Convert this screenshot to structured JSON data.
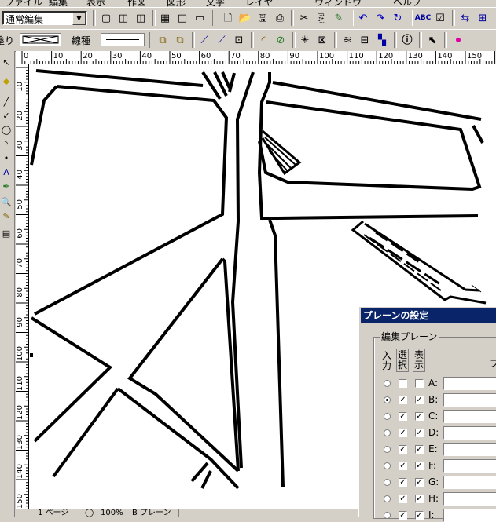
{
  "menu": {
    "items": [
      "ファイル",
      "編集",
      "表示",
      "作図",
      "図形",
      "文字",
      "レイヤ",
      "ウィンドウ",
      "ヘルプ"
    ]
  },
  "toolbar": {
    "mode_combo_value": "通常編集",
    "line_type_label": "線種",
    "clipped_left_label": "塗り"
  },
  "ruler": {
    "h_labels": [
      "0",
      "10",
      "20",
      "30",
      "40",
      "50",
      "60",
      "70",
      "80",
      "90",
      "100",
      "110",
      "120",
      "130",
      "140",
      "150"
    ],
    "v_labels": [
      "10",
      "20",
      "30",
      "40",
      "50",
      "60",
      "70",
      "80",
      "90",
      "100",
      "110",
      "120",
      "130",
      "140",
      "150"
    ]
  },
  "status": {
    "page": "1 ページ",
    "zoom": "100%",
    "plane": "B プレーン"
  },
  "plane_dialog": {
    "title": "プレーンの設定",
    "group_label": "編集プレーン",
    "col_input": "入力",
    "col_select": "選択",
    "col_display": "表示",
    "col_name_clip": "プ",
    "planes": [
      {
        "label": "A:",
        "input": false,
        "select": false,
        "display": false
      },
      {
        "label": "B:",
        "input": true,
        "select": true,
        "display": true
      },
      {
        "label": "C:",
        "input": false,
        "select": true,
        "display": true
      },
      {
        "label": "D:",
        "input": false,
        "select": true,
        "display": true
      },
      {
        "label": "E:",
        "input": false,
        "select": true,
        "display": true
      },
      {
        "label": "F:",
        "input": false,
        "select": true,
        "display": true
      },
      {
        "label": "G:",
        "input": false,
        "select": true,
        "display": true
      },
      {
        "label": "H:",
        "input": false,
        "select": true,
        "display": true
      },
      {
        "label": "I:",
        "input": false,
        "select": true,
        "display": true
      }
    ]
  },
  "icons": {
    "toolbar1": [
      "single-page-icon",
      "two-page-icon",
      "two-page-alt-icon",
      "grid-icon",
      "page-small-icon",
      "page-corner-icon",
      "new-doc-icon",
      "open-icon",
      "save-icon",
      "print-icon",
      "cut-icon",
      "copy-icon",
      "paste-icon",
      "undo-icon",
      "redo-icon",
      "refresh-icon",
      "spellcheck-icon",
      "check-box-icon",
      "arrange-icon",
      "merge-icon"
    ],
    "toolbar2": [
      "group-icon",
      "ungroup-icon",
      "node-edit-icon",
      "node-add-icon",
      "frame-icon",
      "arc-icon",
      "select-all-icon",
      "snowflake-icon",
      "star-box-icon",
      "wave-icon",
      "align-icon",
      "distribute-icon",
      "info-icon",
      "cursor-select-icon",
      "stop-icon"
    ]
  },
  "colors": {
    "title_bar": "#0a246a",
    "face": "#d4d0c8"
  }
}
